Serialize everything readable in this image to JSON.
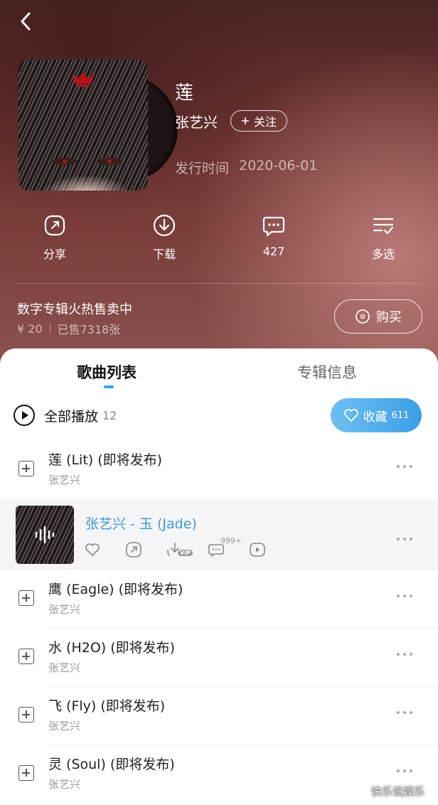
{
  "album": {
    "title": "莲",
    "artist": "张艺兴",
    "follow_label": "关注",
    "release_label": "发行时间",
    "release_date": "2020-06-01"
  },
  "actions": [
    {
      "label": "分享",
      "icon": "share-icon"
    },
    {
      "label": "下载",
      "icon": "download-icon"
    },
    {
      "label": "427",
      "icon": "comment-icon"
    },
    {
      "label": "多选",
      "icon": "multiselect-icon"
    }
  ],
  "promo": {
    "title": "数字专辑火热售卖中",
    "price": "¥ 20",
    "sold": "已售7318张",
    "buy_label": "购买"
  },
  "tabs": {
    "songs": "歌曲列表",
    "info": "专辑信息"
  },
  "playall": {
    "label": "全部播放",
    "count": "12"
  },
  "collect": {
    "label": "收藏",
    "count": "611"
  },
  "songs": [
    {
      "title": "莲 (Lit) (即将发布)",
      "artist": "张艺兴"
    },
    {
      "title": "张艺兴 - 玉 (Jade)",
      "artist": "",
      "playing": true,
      "comment_badge": "999+",
      "vip_label": "VIP"
    },
    {
      "title": "鹰 (Eagle) (即将发布)",
      "artist": "张艺兴"
    },
    {
      "title": "水 (H2O) (即将发布)",
      "artist": "张艺兴"
    },
    {
      "title": "飞 (Fly) (即将发布)",
      "artist": "张艺兴"
    },
    {
      "title": "灵 (Soul) (即将发布)",
      "artist": "张艺兴"
    }
  ],
  "watermark": "快乐说娱乐",
  "colors": {
    "accent": "#31a6e8",
    "playing_title": "#3d97d8",
    "collect_gradient_start": "#6ec0f2",
    "collect_gradient_end": "#3b9ee6"
  }
}
